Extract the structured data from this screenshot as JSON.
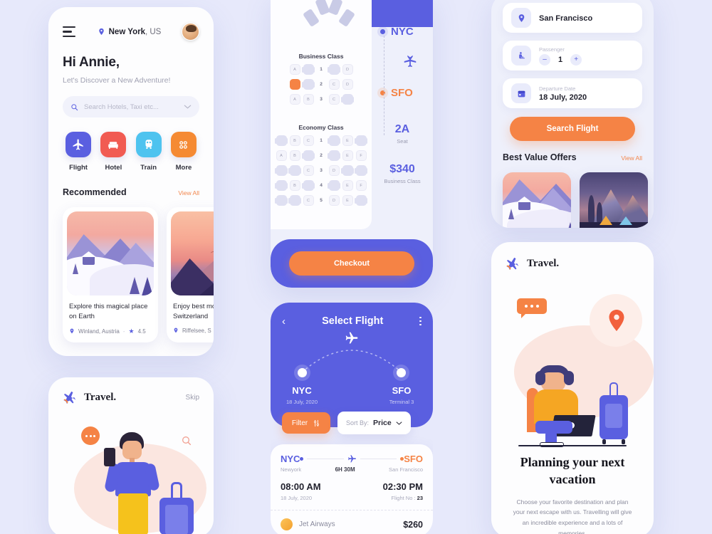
{
  "theme": {
    "bg": "#e7e9fb",
    "primary": "#5a5fe0",
    "accent": "#f58345",
    "card": "#fdfdfe",
    "muted": "#a1a2b3"
  },
  "home": {
    "menu_icon": "hamburger-icon",
    "location_pin_icon": "location-pin-icon",
    "location_city": "New York",
    "location_country": ", US",
    "avatar": "user-avatar",
    "greeting": "Hi Annie,",
    "subtitle": "Let's Discover a New Adventure!",
    "search": {
      "icon": "search-icon",
      "placeholder": "Search Hotels, Taxi etc...",
      "chevron": "chevron-down-icon"
    },
    "categories": [
      {
        "label": "Flight",
        "icon": "airplane-icon",
        "color": "#5a5fe0"
      },
      {
        "label": "Hotel",
        "icon": "bed-icon",
        "color": "#f15b52"
      },
      {
        "label": "Train",
        "icon": "train-icon",
        "color": "#4ec3ef"
      },
      {
        "label": "More",
        "icon": "grid-dots-icon",
        "color": "#f58a33"
      }
    ],
    "recommended": {
      "title": "Recommended",
      "view_all": "View All",
      "cards": [
        {
          "title": "Explore this magical place on Earth",
          "place": "Winland, Austria",
          "dash": "-",
          "rating": "4.5",
          "art": "snow-lake"
        },
        {
          "title": "Enjoy best moments in Switzerland",
          "place": "Riffelsee, S",
          "dash": "-",
          "rating": "",
          "art": "sunset-mountain"
        }
      ]
    }
  },
  "seat_screen": {
    "business_class_label": "Business Class",
    "economy_class_label": "Economy Class",
    "business_rows": [
      {
        "num": "1",
        "left": [
          "A",
          "chair"
        ],
        "right": [
          "chair",
          "D"
        ]
      },
      {
        "num": "2",
        "left": [
          "sel:A",
          "chair"
        ],
        "right": [
          "C",
          "D"
        ]
      },
      {
        "num": "3",
        "left": [
          "A",
          "B"
        ],
        "right": [
          "C",
          "chair"
        ]
      }
    ],
    "economy_rows": [
      {
        "num": "1",
        "left": [
          "chair",
          "B",
          "C"
        ],
        "right": [
          "chair",
          "E",
          "chair"
        ]
      },
      {
        "num": "2",
        "left": [
          "A",
          "B",
          "chair"
        ],
        "right": [
          "chair",
          "E",
          "F"
        ]
      },
      {
        "num": "3",
        "left": [
          "chair",
          "chair",
          "C"
        ],
        "right": [
          "D",
          "chair",
          "chair"
        ]
      },
      {
        "num": "4",
        "left": [
          "chair",
          "B",
          "chair"
        ],
        "right": [
          "chair",
          "E",
          "F"
        ]
      },
      {
        "num": "5",
        "left": [
          "chair",
          "chair",
          "C"
        ],
        "right": [
          "D",
          "E",
          "chair"
        ]
      }
    ],
    "origin": "NYC",
    "destination": "SFO",
    "plane_icon": "airplane-down-icon",
    "seat_value": "2A",
    "seat_caption": "Seat",
    "price_value": "$340",
    "price_caption": "Business Class",
    "checkout_label": "Checkout"
  },
  "select_flight": {
    "back_icon": "chevron-left-icon",
    "title": "Select Flight",
    "menu_icon": "dots-vertical-icon",
    "plane_icon": "airplane-icon",
    "origin": {
      "code": "NYC",
      "sub": "18 July, 2020"
    },
    "destination": {
      "code": "SFO",
      "sub": "Terminal 3"
    },
    "filter_label": "Filter",
    "filter_icon": "sliders-icon",
    "sort_label": "Sort By:",
    "sort_value": "Price",
    "sort_chevron": "chevron-down-icon",
    "flight_card": {
      "from_code": "NYC",
      "from_city": "Newyork",
      "to_code": "SFO",
      "to_city": "San Francisco",
      "duration": "6H 30M",
      "depart_time": "08:00 AM",
      "depart_date": "18 July, 2020",
      "arrive_time": "02:30 PM",
      "flight_no_label": "Flight No :",
      "flight_no": "23",
      "airline": "Jet Airways",
      "price": "$260"
    }
  },
  "search_panel": {
    "fields": [
      {
        "icon": "location-pin-icon",
        "label": "",
        "value": "San Francisco"
      },
      {
        "icon": "passenger-icon",
        "label": "Passenger",
        "value": "1",
        "minus": "–",
        "plus": "+"
      },
      {
        "icon": "calendar-icon",
        "label": "Departure Date",
        "value": "18 July, 2020"
      }
    ],
    "search_button": "Search Flight",
    "offers_title": "Best Value Offers",
    "offers_view_all": "View All",
    "offers": [
      {
        "art": "snow-lake"
      },
      {
        "art": "night-camp"
      }
    ]
  },
  "onboard_right": {
    "brand_icon": "airplane-icon",
    "brand": "Travel.",
    "illustration": "woman-with-laptop-and-suitcase",
    "chat_bubble_icon": "chat-dots-icon",
    "map_pin_icon": "location-pin-icon",
    "heading": "Planning your next vacation",
    "body": "Choose your favorite destination and plan your next escape with us. Travelling will give an incredible experience and a lots of memories."
  },
  "onboard_left": {
    "brand_icon": "airplane-icon",
    "brand": "Travel.",
    "skip": "Skip",
    "illustration": "man-with-phone-and-suitcase",
    "chat_bubble_icon": "chat-dots-icon",
    "search_icon": "search-icon"
  }
}
